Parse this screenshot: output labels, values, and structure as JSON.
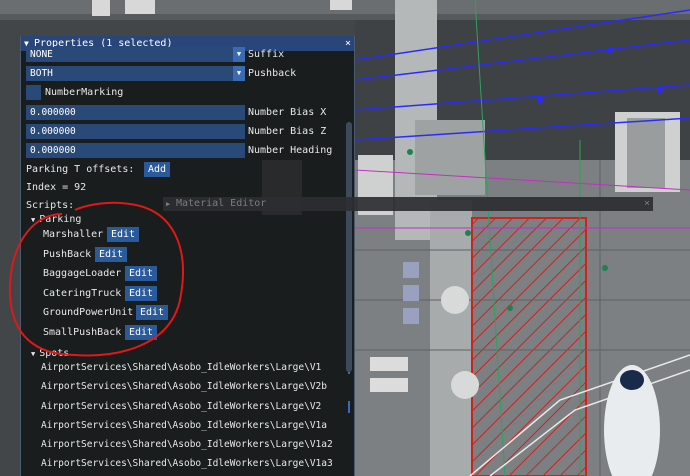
{
  "window": {
    "title": "Properties (1 selected)",
    "close_glyph": "×",
    "collapse_glyph": "▼"
  },
  "fields": [
    {
      "value": "NONE",
      "label": "Suffix",
      "type": "dropdown"
    },
    {
      "value": "BOTH",
      "label": "Pushback",
      "type": "dropdown"
    },
    {
      "value": "",
      "label": "NumberMarking",
      "type": "checkbox"
    },
    {
      "value": "0.000000",
      "label": "Number Bias X",
      "type": "input"
    },
    {
      "value": "0.000000",
      "label": "Number Bias Z",
      "type": "input"
    },
    {
      "value": "0.000000",
      "label": "Number Heading",
      "type": "input"
    }
  ],
  "parking_offsets": {
    "label": "Parking T offsets:",
    "button": "Add"
  },
  "index_text": "Index = 92",
  "scripts_label": "Scripts:",
  "parking_group": {
    "label": "Parking",
    "items": [
      {
        "label": "Marshaller",
        "button": "Edit"
      },
      {
        "label": "PushBack",
        "button": "Edit"
      },
      {
        "label": "BaggageLoader",
        "button": "Edit"
      },
      {
        "label": "CateringTruck",
        "button": "Edit"
      },
      {
        "label": "GroundPowerUnit",
        "button": "Edit"
      },
      {
        "label": "SmallPushBack",
        "button": "Edit"
      }
    ]
  },
  "spots_group": {
    "label": "Spots",
    "items": [
      "AirportServices\\Shared\\Asobo_IdleWorkers\\Large\\V1",
      "AirportServices\\Shared\\Asobo_IdleWorkers\\Large\\V2b",
      "AirportServices\\Shared\\Asobo_IdleWorkers\\Large\\V2",
      "AirportServices\\Shared\\Asobo_IdleWorkers\\Large\\V1a",
      "AirportServices\\Shared\\Asobo_IdleWorkers\\Large\\V1a2",
      "AirportServices\\Shared\\Asobo_IdleWorkers\\Large\\V1a3"
    ]
  },
  "material_editor": {
    "title": "Material Editor",
    "close_glyph": "×"
  },
  "colors": {
    "titlebar": "#28467a",
    "field": "#294a78",
    "button": "#2b5a9a",
    "annotation": "#e01818",
    "overlay_lines": "#2a2aff"
  }
}
